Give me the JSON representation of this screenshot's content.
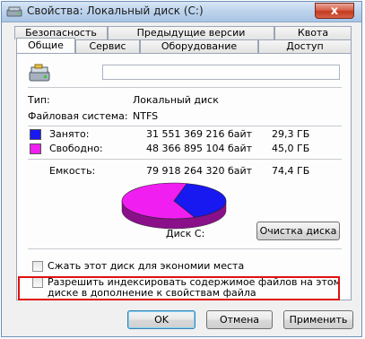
{
  "window": {
    "title": "Свойства: Локальный диск (C:)",
    "close_label": "x"
  },
  "tabs_row1": [
    "Безопасность",
    "Предыдущие версии",
    "Квота"
  ],
  "tabs_row2": [
    "Общие",
    "Сервис",
    "Оборудование",
    "Доступ"
  ],
  "active_tab": "Общие",
  "general": {
    "drive_name_value": "",
    "type_label": "Тип:",
    "type_value": "Локальный диск",
    "fs_label": "Файловая система:",
    "fs_value": "NTFS",
    "used_label": "Занято:",
    "used_bytes": "31 551 369 216 байт",
    "used_gb": "29,3 ГБ",
    "free_label": "Свободно:",
    "free_bytes": "48 366 895 104 байт",
    "free_gb": "45,0 ГБ",
    "capacity_label": "Емкость:",
    "capacity_bytes": "79 918 264 320 байт",
    "capacity_gb": "74,4 ГБ",
    "disk_label": "Диск C:",
    "cleanup_button": "Очистка диска",
    "used_fraction": 0.395,
    "colors": {
      "used": "#1818f0",
      "free": "#f01ef0",
      "used_side": "#10108a",
      "free_side": "#8a108a"
    }
  },
  "options": {
    "compress_label": "Сжать этот диск для экономии места",
    "compress_checked": false,
    "index_label_line1": "Разрешить индексировать содержимое файлов на этом",
    "index_label_line2": "диске в дополнение к свойствам файла",
    "index_checked": false
  },
  "buttons": {
    "ok": "OK",
    "cancel": "Отмена",
    "apply": "Применить"
  }
}
